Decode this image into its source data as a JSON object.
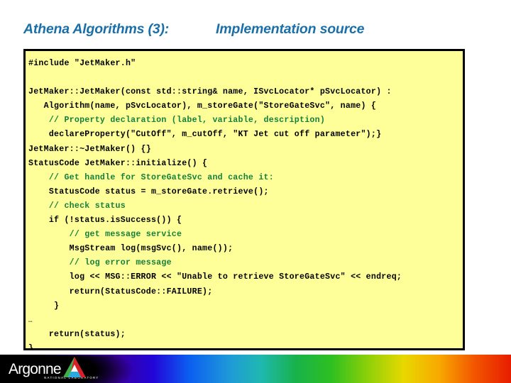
{
  "slide": {
    "title_main": "Athena Algorithms (3):",
    "title_sub": "Implementation source",
    "title_color": "#1B6FA8",
    "code_background": "#ffff99",
    "code_border_color": "#000000",
    "comment_color": "#13803C",
    "code_text_color": "#000000"
  },
  "code": {
    "lines": [
      {
        "text": "#include \"JetMaker.h\"",
        "kind": "code"
      },
      {
        "text": " ",
        "kind": "blank"
      },
      {
        "text": "JetMaker::JetMaker(const std::string& name, ISvcLocator* pSvcLocator) :",
        "kind": "code"
      },
      {
        "text": "   Algorithm(name, pSvcLocator), m_storeGate(\"StoreGateSvc\", name) {",
        "kind": "code"
      },
      {
        "text": "    // Property declaration (label, variable, description)",
        "kind": "comment"
      },
      {
        "text": "    declareProperty(\"CutOff\", m_cutOff, \"KT Jet cut off parameter\");}",
        "kind": "code"
      },
      {
        "text": "JetMaker::~JetMaker() {}",
        "kind": "code"
      },
      {
        "text": "StatusCode JetMaker::initialize() {",
        "kind": "code"
      },
      {
        "text": "    // Get handle for StoreGateSvc and cache it:",
        "kind": "comment"
      },
      {
        "text": "    StatusCode status = m_storeGate.retrieve();",
        "kind": "code"
      },
      {
        "text": "    // check status",
        "kind": "comment"
      },
      {
        "text": "    if (!status.isSuccess()) {",
        "kind": "code"
      },
      {
        "text": "        // get message service",
        "kind": "comment"
      },
      {
        "text": "        MsgStream log(msgSvc(), name());",
        "kind": "code"
      },
      {
        "text": "        // log error message",
        "kind": "comment"
      },
      {
        "text": "        log << MSG::ERROR << \"Unable to retrieve StoreGateSvc\" << endreq;",
        "kind": "code"
      },
      {
        "text": "        return(StatusCode::FAILURE);",
        "kind": "code"
      },
      {
        "text": "     }",
        "kind": "code"
      },
      {
        "text": "…",
        "kind": "ellipsis"
      },
      {
        "text": "    return(status);",
        "kind": "code"
      },
      {
        "text": "}",
        "kind": "code"
      }
    ]
  },
  "footer": {
    "logo_wordmark": "Argonne",
    "logo_tagline": "NATIONAL LABORATORY",
    "gradient_stops": [
      "#000000",
      "#3a00a0",
      "#2205d8",
      "#0b5ef0",
      "#1fb8b0",
      "#18b24a",
      "#8ed008",
      "#e8d800",
      "#f8a800",
      "#e81c00"
    ],
    "logo_mark_colors": {
      "red": "#d92027",
      "green": "#3fae49",
      "blue": "#2aa8e0",
      "white": "#ffffff"
    }
  }
}
